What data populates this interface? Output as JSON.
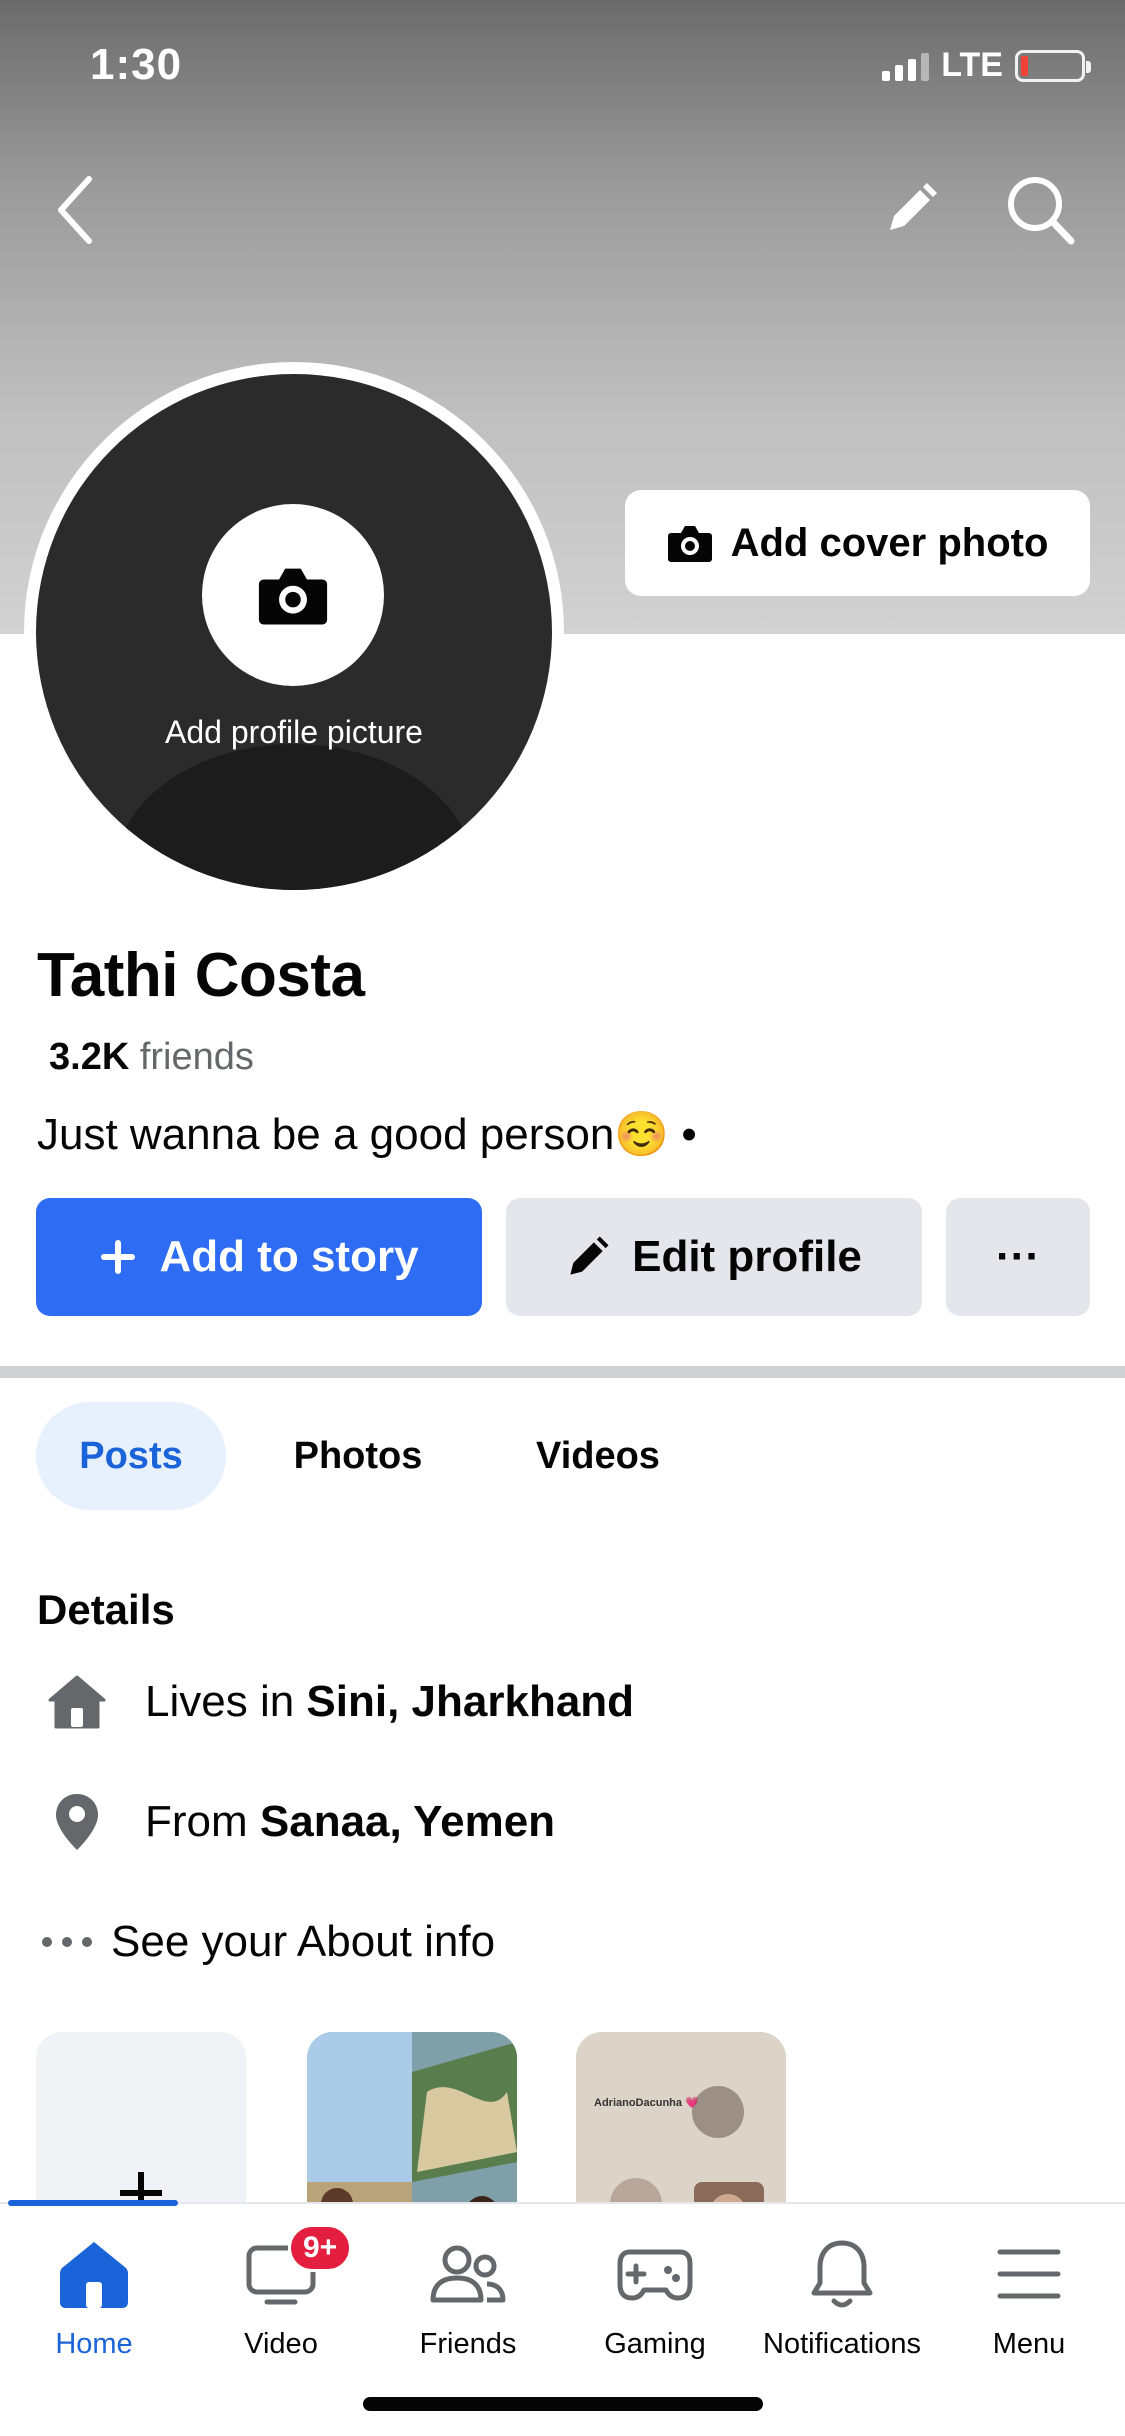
{
  "status": {
    "time": "1:30",
    "network": "LTE"
  },
  "cover": {
    "add_cover_label": "Add cover photo"
  },
  "avatar": {
    "label": "Add profile picture"
  },
  "profile": {
    "name": "Tathi Costa",
    "friends_count": "3.2K",
    "friends_label": "friends",
    "bio": "Just wanna be a good person☺️ •"
  },
  "actions": {
    "add_story": "Add to story",
    "edit_profile": "Edit profile",
    "more": "···"
  },
  "tabs": [
    {
      "label": "Posts",
      "active": true
    },
    {
      "label": "Photos",
      "active": false
    },
    {
      "label": "Videos",
      "active": false
    }
  ],
  "details": {
    "title": "Details",
    "lives_prefix": "Lives in ",
    "lives_value": "Sini, Jharkhand",
    "from_prefix": "From ",
    "from_value": "Sanaa, Yemen",
    "about": "See your About info"
  },
  "thumbnails": {
    "caption": "AdrianoDacunha 💗"
  },
  "nav": {
    "items": [
      {
        "label": "Home",
        "icon": "home-icon",
        "active": true
      },
      {
        "label": "Video",
        "icon": "video-icon",
        "badge": "9+"
      },
      {
        "label": "Friends",
        "icon": "friends-icon"
      },
      {
        "label": "Gaming",
        "icon": "gaming-icon"
      },
      {
        "label": "Notifications",
        "icon": "bell-icon"
      },
      {
        "label": "Menu",
        "icon": "menu-icon"
      }
    ]
  },
  "colors": {
    "accent": "#1b63d8",
    "primary_button": "#2d6cf3",
    "secondary_button": "#e4e6eb",
    "badge": "#e41e3f"
  }
}
